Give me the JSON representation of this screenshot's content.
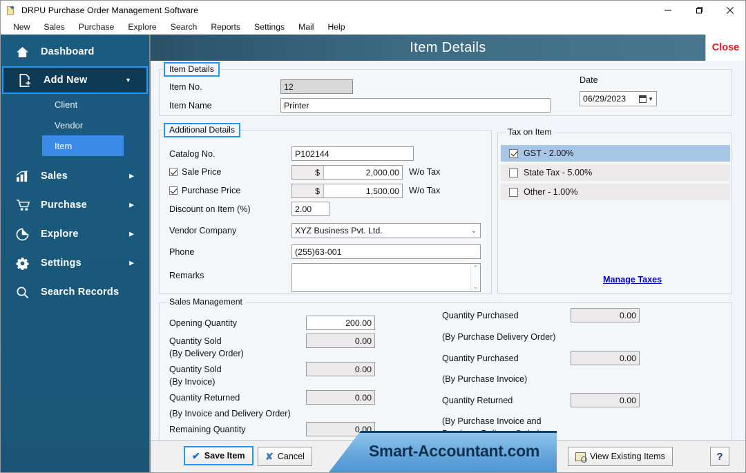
{
  "window": {
    "title": "DRPU Purchase Order Management Software",
    "icon": "app-icon",
    "controls": {
      "minimize": "minimize-icon",
      "maximize": "maximize-icon",
      "close": "close-icon"
    }
  },
  "menubar": {
    "items": [
      "New",
      "Sales",
      "Purchase",
      "Explore",
      "Search",
      "Reports",
      "Settings",
      "Mail",
      "Help"
    ]
  },
  "sidebar": {
    "items": [
      {
        "label": "Dashboard",
        "icon": "home-icon",
        "arrow": ""
      },
      {
        "label": "Add New",
        "icon": "add-document-icon",
        "arrow": "▼"
      },
      {
        "label": "Sales",
        "icon": "bar-chart-icon",
        "arrow": "▶"
      },
      {
        "label": "Purchase",
        "icon": "cart-icon",
        "arrow": "▶"
      },
      {
        "label": "Explore",
        "icon": "pie-chart-icon",
        "arrow": "▶"
      },
      {
        "label": "Settings",
        "icon": "gear-icon",
        "arrow": "▶"
      },
      {
        "label": "Search Records",
        "icon": "search-icon",
        "arrow": ""
      }
    ],
    "subitems": [
      {
        "label": "Client",
        "selected": false
      },
      {
        "label": "Vendor",
        "selected": false
      },
      {
        "label": "Item",
        "selected": true
      }
    ]
  },
  "header": {
    "title": "Item Details",
    "close_label": "Close"
  },
  "item_details": {
    "legend": "Item Details",
    "item_no_label": "Item No.",
    "item_no_value": "12",
    "item_name_label": "Item Name",
    "item_name_value": "Printer",
    "date_label": "Date",
    "date_value": "06/29/2023"
  },
  "additional_details": {
    "legend": "Additional Details",
    "catalog_label": "Catalog No.",
    "catalog_value": "P102144",
    "sale_price_label": "Sale Price",
    "sale_price_checked": true,
    "sale_price_currency": "$",
    "sale_price_value": "2,000.00",
    "sale_price_suffix": "W/o Tax",
    "purchase_price_label": "Purchase Price",
    "purchase_price_checked": true,
    "purchase_price_currency": "$",
    "purchase_price_value": "1,500.00",
    "purchase_price_suffix": "W/o Tax",
    "discount_label": "Discount on Item (%)",
    "discount_value": "2.00",
    "vendor_label": "Vendor Company",
    "vendor_value": "XYZ Business Pvt. Ltd.",
    "phone_label": "Phone",
    "phone_value": "(255)63-001",
    "remarks_label": "Remarks",
    "remarks_value": ""
  },
  "tax_on_item": {
    "legend": "Tax on Item",
    "rows": [
      {
        "label": "GST - 2.00%",
        "checked": true,
        "selected": true
      },
      {
        "label": "State Tax - 5.00%",
        "checked": false,
        "selected": false
      },
      {
        "label": "Other - 1.00%",
        "checked": false,
        "selected": false
      }
    ],
    "manage_link": "Manage Taxes"
  },
  "sales_management": {
    "legend": "Sales Management",
    "left": [
      {
        "label": "Opening Quantity",
        "sub": "",
        "value": "200.00",
        "readonly": false
      },
      {
        "label": "Quantity Sold",
        "sub": "(By Delivery Order)",
        "value": "0.00",
        "readonly": true
      },
      {
        "label": "Quantity Sold",
        "sub": "(By Invoice)",
        "value": "0.00",
        "readonly": true
      },
      {
        "label": "Quantity Returned",
        "sub": "(By Invoice and Delivery Order)",
        "value": "0.00",
        "readonly": true
      },
      {
        "label": "Remaining Quantity",
        "sub": "",
        "value": "0.00",
        "readonly": true
      }
    ],
    "right": [
      {
        "label": "Quantity Purchased",
        "sub": "(By Purchase Delivery Order)",
        "value": "0.00",
        "readonly": true
      },
      {
        "label": "Quantity Purchased",
        "sub": "(By Purchase Invoice)",
        "value": "0.00",
        "readonly": true
      },
      {
        "label": "Quantity Returned",
        "sub": "(By Purchase Invoice and",
        "sub2": "Purchase Delivery Order)",
        "value": "0.00",
        "readonly": true
      }
    ]
  },
  "footer": {
    "save_label": "Save Item",
    "cancel_label": "Cancel",
    "brand": "Smart-Accountant.com",
    "view_existing_label": "View Existing Items",
    "help_label": "?"
  },
  "colors": {
    "sidebar_bg": "#1a5a7e",
    "accent_focus": "#2196f3",
    "selection": "#3b8ae8",
    "header_gradient_start": "#2b5169",
    "header_gradient_end": "#4a7890",
    "close_red": "#e8171f",
    "link_blue": "#0000cc",
    "tax_selected": "#a8c6e5"
  }
}
